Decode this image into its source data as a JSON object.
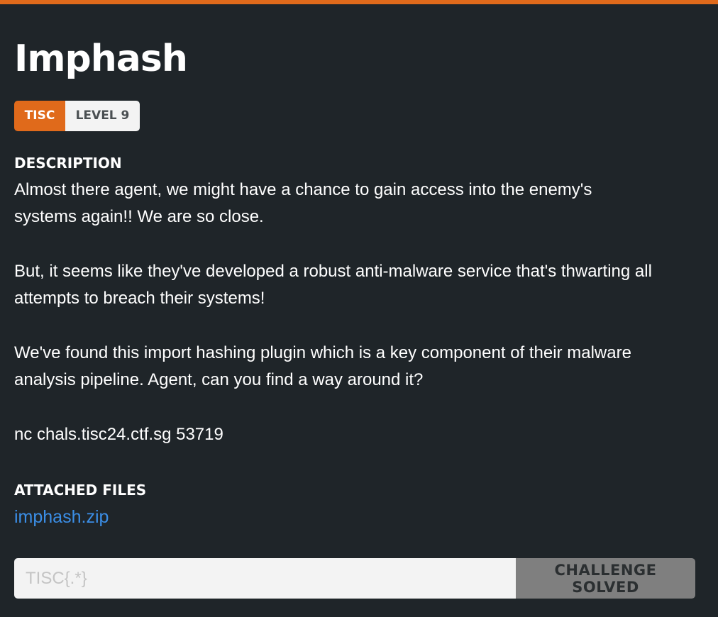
{
  "challenge": {
    "title": "Imphash",
    "tags": {
      "category": "TISC",
      "level": "LEVEL 9"
    }
  },
  "description": {
    "heading": "DESCRIPTION",
    "paragraphs": [
      "Almost there agent, we might have a chance to gain access into the enemy's\nsystems again!! We are so close.",
      "But, it seems like they've developed a robust anti-malware service that's thwarting all\nattempts to breach their systems!",
      "We've found this import hashing plugin which is a key component of their malware\nanalysis pipeline. Agent, can you find a way around it?",
      "nc chals.tisc24.ctf.sg 53719"
    ]
  },
  "attachments": {
    "heading": "ATTACHED FILES",
    "files": [
      {
        "name": "imphash.zip"
      }
    ]
  },
  "flag_form": {
    "value": "",
    "placeholder": "TISC{.*}",
    "button_label": "CHALLENGE SOLVED"
  },
  "colors": {
    "accent": "#e06a1b",
    "background": "#1f2529",
    "link": "#3b8ee6",
    "button_disabled": "#7f7f7f"
  }
}
